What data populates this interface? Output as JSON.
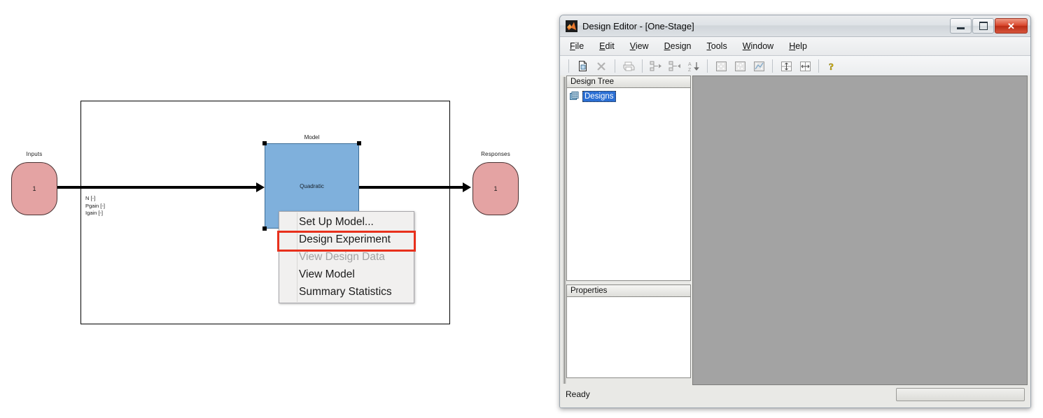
{
  "diagram": {
    "inputs_node": {
      "label": "Inputs",
      "value": "1"
    },
    "responses_node": {
      "label": "Responses",
      "value": "1"
    },
    "model_block": {
      "label": "Model",
      "text": "Quadratic"
    },
    "signal_labels": [
      "N [-]",
      "Pgain [-]",
      "Igain [-]"
    ],
    "colors": {
      "node_fill": "#e4a3a3",
      "model_fill": "#7fb0dc",
      "highlight_border": "#e8301c"
    }
  },
  "context_menu": {
    "items": [
      {
        "label": "Set Up Model...",
        "disabled": false,
        "highlighted": false
      },
      {
        "label": "Design Experiment",
        "disabled": false,
        "highlighted": true
      },
      {
        "label": "View Design Data",
        "disabled": true,
        "highlighted": false
      },
      {
        "label": "View Model",
        "disabled": false,
        "highlighted": false
      },
      {
        "label": "Summary Statistics",
        "disabled": false,
        "highlighted": false
      }
    ]
  },
  "design_editor": {
    "title": "Design Editor - [One-Stage]",
    "app_icon": "matlab-icon",
    "window_controls": {
      "minimize": "minimize-icon",
      "restore": "restore-icon",
      "close": "✕"
    },
    "menu_bar": [
      {
        "accel": "F",
        "rest": "ile"
      },
      {
        "accel": "E",
        "rest": "dit"
      },
      {
        "accel": "V",
        "rest": "iew"
      },
      {
        "accel": "D",
        "rest": "esign"
      },
      {
        "accel": "T",
        "rest": "ools"
      },
      {
        "accel": "W",
        "rest": "indow"
      },
      {
        "accel": "H",
        "rest": "elp"
      }
    ],
    "toolbar": [
      {
        "name": "new-design-icon",
        "enabled": true
      },
      {
        "name": "delete-icon",
        "enabled": false
      },
      {
        "name": "separator"
      },
      {
        "name": "print-icon",
        "enabled": false
      },
      {
        "name": "separator"
      },
      {
        "name": "promote-design-icon",
        "enabled": false
      },
      {
        "name": "demote-design-icon",
        "enabled": false
      },
      {
        "name": "sort-az-icon",
        "enabled": false
      },
      {
        "name": "separator"
      },
      {
        "name": "view-design-2d-icon",
        "enabled": false
      },
      {
        "name": "view-design-3d-icon",
        "enabled": false
      },
      {
        "name": "view-design-plot-icon",
        "enabled": false
      },
      {
        "name": "separator"
      },
      {
        "name": "split-horizontal-icon",
        "enabled": false
      },
      {
        "name": "split-vertical-icon",
        "enabled": false
      },
      {
        "name": "separator"
      },
      {
        "name": "help-icon",
        "enabled": true
      }
    ],
    "design_tree": {
      "header": "Design Tree",
      "root_item": {
        "label": "Designs",
        "selected": true,
        "icon": "designs-grid-icon"
      }
    },
    "properties": {
      "header": "Properties",
      "rows": []
    },
    "status_bar": {
      "text": "Ready",
      "progress_value": ""
    }
  }
}
